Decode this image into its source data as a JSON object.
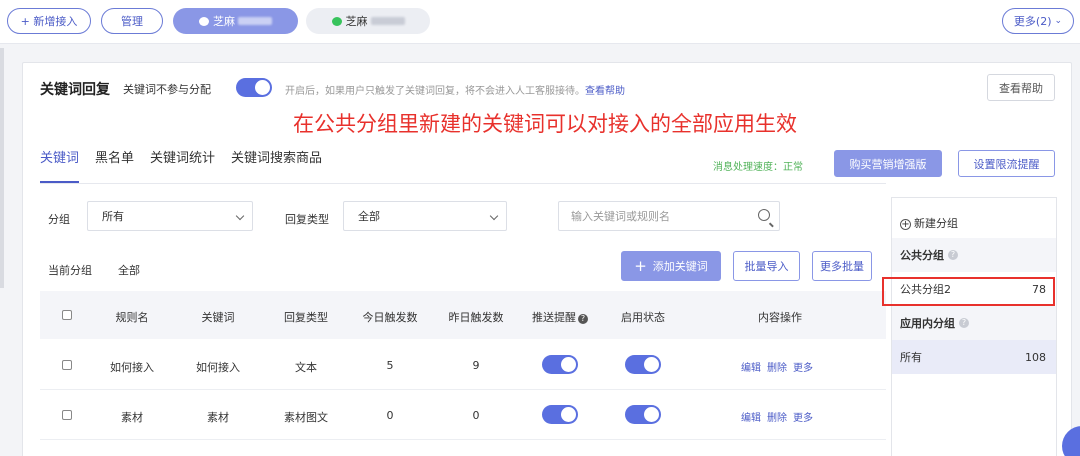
{
  "topbar": {
    "add_access": "+ 新增接入",
    "manage": "管理",
    "account_1": "芝麻",
    "account_2": "芝麻",
    "more": "更多(2)"
  },
  "header": {
    "title": "关键词回复",
    "sub": "关键词不参与分配",
    "hint": "开启后，如果用户只触发了关键词回复，将不会进入人工客服接待。",
    "hint_link": "查看帮助",
    "help_button": "查看帮助",
    "toggle_on": true
  },
  "annotation": "在公共分组里新建的关键词可以对接入的全部应用生效",
  "tabs": [
    "关键词",
    "黑名单",
    "关键词统计",
    "关键词搜索商品"
  ],
  "speed": "消息处理速度：正常",
  "buttons": {
    "buy": "购买营销增强版",
    "limit": "设置限流提醒",
    "add_keyword": "添加关键词",
    "batch_import": "批量导入",
    "more_batch": "更多批量"
  },
  "filters": {
    "group_label": "分组",
    "group_value": "所有",
    "type_label": "回复类型",
    "type_value": "全部",
    "search_placeholder": "输入关键词或规则名",
    "current_group_label": "当前分组",
    "current_group_value": "全部"
  },
  "table": {
    "columns": [
      "规则名",
      "关键词",
      "回复类型",
      "今日触发数",
      "昨日触发数",
      "推送提醒",
      "启用状态",
      "内容操作"
    ],
    "rows": [
      {
        "rule": "如何接入",
        "keyword": "如何接入",
        "type": "文本",
        "today": "5",
        "yesterday": "9",
        "push": true,
        "enabled": true
      },
      {
        "rule": "素材",
        "keyword": "素材",
        "type": "素材图文",
        "today": "0",
        "yesterday": "0",
        "push": true,
        "enabled": true
      }
    ],
    "ops": [
      "编辑",
      "删除",
      "更多"
    ]
  },
  "groups": {
    "new_group": "新建分组",
    "public_section": "公共分组",
    "public_items": [
      {
        "name": "公共分组2",
        "count": "78"
      }
    ],
    "app_section": "应用内分组",
    "app_items": [
      {
        "name": "所有",
        "count": "108"
      }
    ]
  },
  "colors": {
    "brand": "#5a6fe0",
    "annotation_red": "#e8312c",
    "speed_green": "#52b35a"
  }
}
